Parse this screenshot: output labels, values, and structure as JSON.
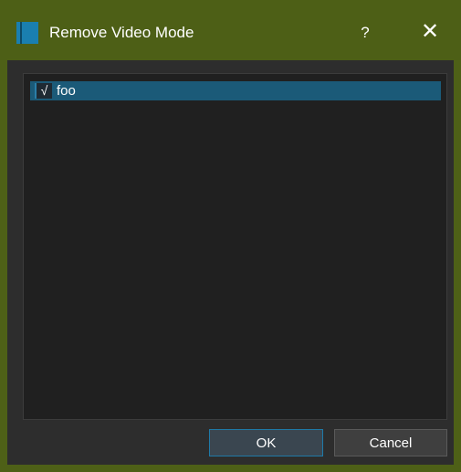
{
  "window": {
    "title": "Remove Video Mode",
    "help_label": "?",
    "close_label": "✕",
    "accent": "#4d5f16",
    "icon": "app-icon"
  },
  "list": {
    "items": [
      {
        "label": "foo",
        "checked": true,
        "check_glyph": "√"
      }
    ],
    "selected_color": "#1b5a78"
  },
  "buttons": {
    "ok_label": "OK",
    "cancel_label": "Cancel"
  }
}
